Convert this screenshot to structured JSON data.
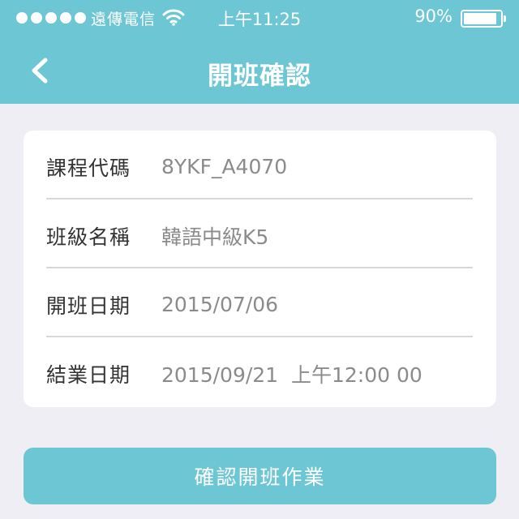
{
  "status_bar": {
    "carrier": "遠傳電信",
    "time": "上午11:25",
    "battery_percent": "90%",
    "battery_level": 0.9
  },
  "nav": {
    "title": "開班確認",
    "back_icon": "chevron-left-icon"
  },
  "details": [
    {
      "label": "課程代碼",
      "value": "8YKF_A4070"
    },
    {
      "label": "班級名稱",
      "value": "韓語中級K5"
    },
    {
      "label": "開班日期",
      "value": "2015/07/06"
    },
    {
      "label": "結業日期",
      "value": "2015/09/21  上午12:00 00"
    }
  ],
  "confirm_button": {
    "label": "確認開班作業"
  },
  "colors": {
    "accent": "#6cc6d4",
    "background": "#efeef4",
    "card": "#ffffff",
    "label_text": "#333333",
    "value_text": "#8b8b8b"
  }
}
